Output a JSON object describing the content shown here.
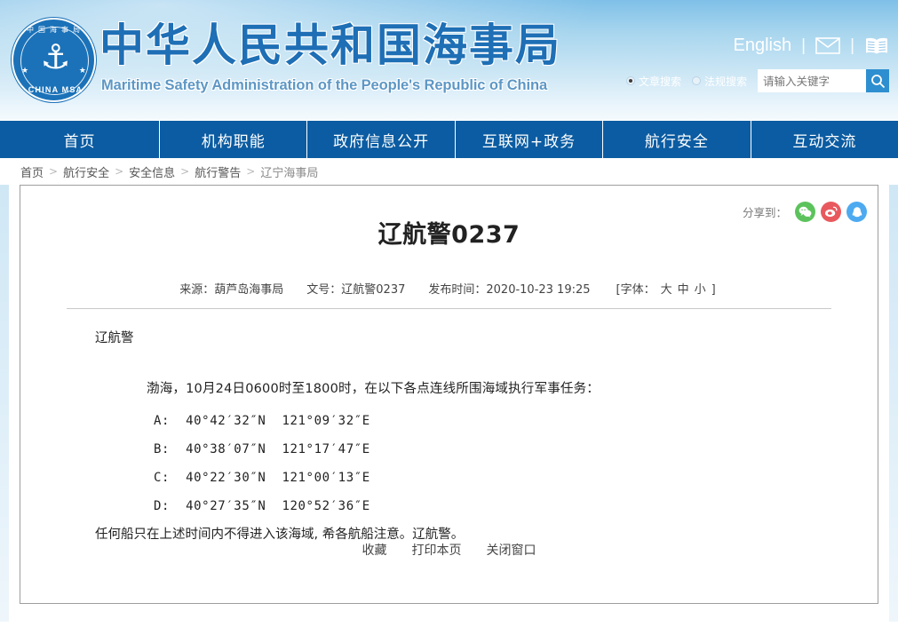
{
  "site": {
    "logo": {
      "top_text": "中国海事局",
      "bottom_text": "CHINA MSA",
      "anchor_icon": "anchor-icon"
    },
    "title_cn": "中华人民共和国海事局",
    "title_en": "Maritime Safety Administration of the People's Republic of China"
  },
  "topbar": {
    "english_label": "English",
    "separator": "|",
    "mail_icon": "mail-icon",
    "book_icon": "book-icon"
  },
  "search": {
    "options": [
      {
        "label": "文章搜索",
        "selected": true
      },
      {
        "label": "法规搜索",
        "selected": false
      }
    ],
    "placeholder": "请输入关键字",
    "value": "",
    "button_icon": "search-icon",
    "button_color": "#2e8fd0"
  },
  "nav": {
    "items": [
      {
        "label": "首页"
      },
      {
        "label": "机构职能"
      },
      {
        "label": "政府信息公开"
      },
      {
        "label": "互联网+政务"
      },
      {
        "label": "航行安全"
      },
      {
        "label": "互动交流"
      }
    ],
    "background": "#0b5ca2"
  },
  "breadcrumb": {
    "items": [
      "首页",
      "航行安全",
      "安全信息",
      "航行警告",
      "辽宁海事局"
    ],
    "separator": ">"
  },
  "share": {
    "label": "分享到：",
    "targets": [
      {
        "name": "wechat",
        "icon": "wechat-icon",
        "color": "#5cc35c"
      },
      {
        "name": "weibo",
        "icon": "weibo-icon",
        "color": "#e8595e"
      },
      {
        "name": "qq",
        "icon": "qq-icon",
        "color": "#4daaf0"
      }
    ]
  },
  "document": {
    "title": "辽航警0237",
    "meta": {
      "source": "来源：葫芦岛海事局",
      "doc_number": "文号：辽航警0237",
      "publish_time": "发布时间：2020-10-23 19:25",
      "fontsize_prefix": "[字体：",
      "fontsize_large": "大",
      "fontsize_medium": "中",
      "fontsize_small": "小",
      "fontsize_suffix": "]"
    },
    "heading": "辽航警",
    "lead": "渤海，10月24日0600时至1800时，在以下各点连线所围海域执行军事任务：",
    "coordinates": [
      "A:  40°42′32″N  121°09′32″E",
      "B:  40°38′07″N  121°17′47″E",
      "C:  40°22′30″N  121°00′13″E",
      "D:  40°27′35″N  120°52′36″E"
    ],
    "tail": "任何船只在上述时间内不得进入该海域, 希各航船注意。辽航警。"
  },
  "doc_actions": {
    "favorite": "收藏",
    "print": "打印本页",
    "close": "关闭窗口"
  }
}
